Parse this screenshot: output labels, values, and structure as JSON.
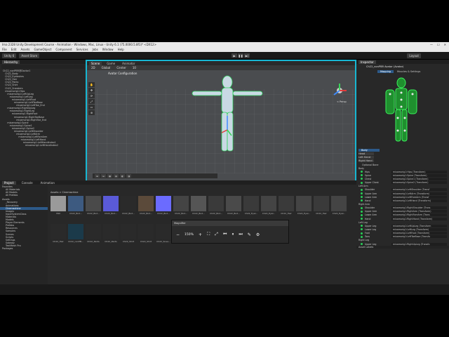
{
  "window": {
    "title": "Ima 2328 Unity Development Course - Animation - Windows, Mac, Linux - Unity 6.1 (75.0000.5.8f1)* <DX12>",
    "controls": [
      "—",
      "☐",
      "✕"
    ]
  },
  "menu": [
    "File",
    "Edit",
    "Assets",
    "GameObject",
    "Component",
    "Services",
    "Jobs",
    "Window",
    "Help"
  ],
  "toolbar": {
    "account": "Unity 6",
    "asset_store": "Asset Store",
    "layout": "Layout"
  },
  "hierarchy": {
    "tab": "Hierarchy",
    "items": [
      {
        "label": "Ch22_nonPBR@Doctor1",
        "indent": 0
      },
      {
        "label": "Ch22_Body",
        "indent": 1
      },
      {
        "label": "Ch22_Eyelashes",
        "indent": 1
      },
      {
        "label": "Ch22_Hair",
        "indent": 1
      },
      {
        "label": "Ch22_Pants",
        "indent": 1
      },
      {
        "label": "Ch22_Shirt",
        "indent": 1
      },
      {
        "label": "Ch22_Sneakers",
        "indent": 1
      },
      {
        "label": "mixamorig1:Hips",
        "indent": 1
      },
      {
        "label": "mixamorig1:LeftUpLeg",
        "indent": 2
      },
      {
        "label": "mixamorig1:LeftLeg",
        "indent": 3
      },
      {
        "label": "mixamorig1:LeftFoot",
        "indent": 4
      },
      {
        "label": "mixamorig1:LeftToeBase",
        "indent": 5
      },
      {
        "label": "mixamorig1:LeftToe_End",
        "indent": 6
      },
      {
        "label": "mixamorig1:RightUpLeg",
        "indent": 2
      },
      {
        "label": "mixamorig1:RightLeg",
        "indent": 3
      },
      {
        "label": "mixamorig1:RightFoot",
        "indent": 4
      },
      {
        "label": "mixamorig1:RightToeBase",
        "indent": 5
      },
      {
        "label": "mixamorig1:RightToe_End",
        "indent": 6
      },
      {
        "label": "mixamorig1:Spine",
        "indent": 2
      },
      {
        "label": "mixamorig1:Spine1",
        "indent": 3
      },
      {
        "label": "mixamorig1:Spine2",
        "indent": 4
      },
      {
        "label": "mixamorig1:LeftShoulder",
        "indent": 5
      },
      {
        "label": "mixamorig1:LeftArm",
        "indent": 6
      },
      {
        "label": "mixamorig1:LeftForeArm",
        "indent": 7
      },
      {
        "label": "mixamorig1:LeftHand",
        "indent": 8
      },
      {
        "label": "mixamorig1:LeftHandIndex1",
        "indent": 9
      },
      {
        "label": "mixamorig1:LeftHandIndex2",
        "indent": 10
      }
    ]
  },
  "scene": {
    "tabs": [
      "Scene",
      "Game",
      "Animator"
    ],
    "header": "Avatar Configuration",
    "persp": "< Persp",
    "view_options": [
      "2D",
      "Global",
      "Center",
      "10"
    ]
  },
  "inspector": {
    "tab": "Inspector",
    "object_name": "Ch22_nonPBR Avatar (Avatar)",
    "tabs": [
      "Mapping",
      "Muscles & Settings"
    ],
    "body_parts": [
      "Body",
      "Head",
      "Left Hand",
      "Right Hand"
    ],
    "optional_bone": "Optional Bone",
    "groups": [
      {
        "name": "Body",
        "bones": [
          {
            "name": "Hips",
            "value": "mixamorig1:Hips (Transform)"
          },
          {
            "name": "Spine",
            "value": "mixamorig1:Spine (Transform)"
          },
          {
            "name": "Chest",
            "value": "mixamorig1:Spine1 (Transform)"
          },
          {
            "name": "Upper Chest",
            "value": "mixamorig1:Spine2 (Transform)"
          }
        ]
      },
      {
        "name": "Left Arm",
        "bones": [
          {
            "name": "Shoulder",
            "value": "mixamorig1:LeftShoulder (Transf"
          },
          {
            "name": "Upper Arm",
            "value": "mixamorig1:LeftArm (Transform)"
          },
          {
            "name": "Lower Arm",
            "value": "mixamorig1:LeftForeArm (Transf"
          },
          {
            "name": "Hand",
            "value": "mixamorig1:LeftHand (Transform)"
          }
        ]
      },
      {
        "name": "Right Arm",
        "bones": [
          {
            "name": "Shoulder",
            "value": "mixamorig1:RightShoulder (Trans"
          },
          {
            "name": "Upper Arm",
            "value": "mixamorig1:RightArm (Transform)"
          },
          {
            "name": "Lower Arm",
            "value": "mixamorig1:RightForeArm (Trans"
          },
          {
            "name": "Hand",
            "value": "mixamorig1:RightHand (Transform)"
          }
        ]
      },
      {
        "name": "Left Leg",
        "bones": [
          {
            "name": "Upper Leg",
            "value": "mixamorig1:LeftUpLeg (Transform"
          },
          {
            "name": "Lower Leg",
            "value": "mixamorig1:LeftLeg (Transform)"
          },
          {
            "name": "Foot",
            "value": "mixamorig1:LeftFoot (Transform)"
          },
          {
            "name": "Toes",
            "value": "mixamorig1:LeftToeBase (Transfo"
          }
        ]
      },
      {
        "name": "Right Leg",
        "bones": [
          {
            "name": "Upper Leg",
            "value": "mixamorig1:RightUpLeg (Transfo"
          }
        ]
      }
    ],
    "footer": "Asset Labels"
  },
  "project": {
    "tabs": [
      "Project",
      "Console",
      "Animation"
    ],
    "breadcrumb": "Assets > Cinemachine",
    "favorites": [
      "Favorites",
      "All Materials",
      "All Models",
      "All Prefabs"
    ],
    "assets_tree": [
      "Assets",
      "_Recovery",
      "Animations",
      "Cinemachine",
      "Images",
      "InputSystemClass",
      "Materials",
      "Models",
      "Player Elements",
      "Prefabs",
      "Resources",
      "Samples",
      "Scenes",
      "Scripts",
      "Settings",
      "Sobway",
      "TextMesh Pro",
      "Packages"
    ],
    "row1": [
      "Mat",
      "Ch22_Bod...",
      "Ch22_Bod...",
      "Ch22_Bod...",
      "Ch22_Bod...",
      "Ch22_Bod...",
      "Ch22_Bod...",
      "Ch22_Bod...",
      "Ch22_Bod...",
      "Ch22_Bod...",
      "Ch22_Bod...",
      "Ch22_Eyel...",
      "Ch22_Eyel...",
      "Ch22_Hair",
      "Ch22_Eyel...",
      "Ch22_Hair",
      "Ch22_Eyel..."
    ],
    "row2": [
      "Ch22_Hair",
      "Ch22_nonPB...",
      "Ch22_Pants",
      "Ch22_Pants",
      "Ch22_Shirt",
      "Ch22_Shirt",
      "Ch22_Snea..."
    ]
  },
  "magnifier": {
    "title": "Magnifier",
    "zoom": "150%"
  },
  "colors": {
    "accent": "#17b7d2",
    "bone_ok": "#27d157",
    "selection": "#2d5a8a"
  }
}
